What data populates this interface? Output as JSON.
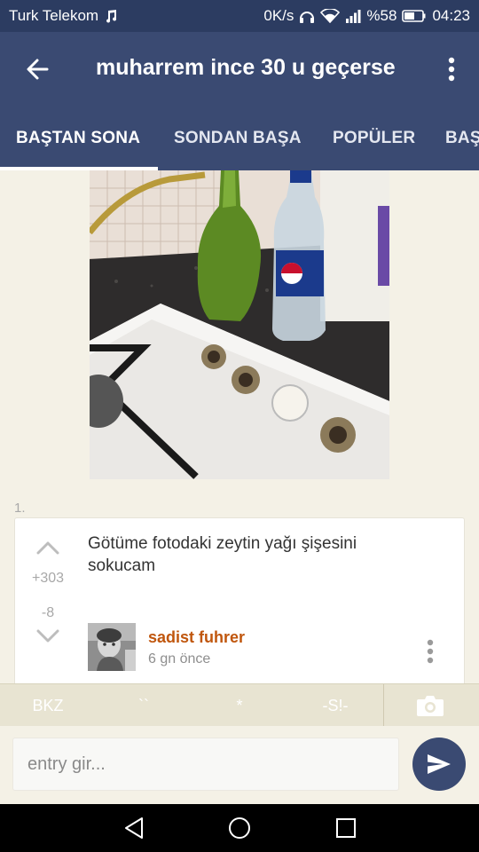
{
  "status_bar": {
    "carrier": "Turk Telekom",
    "net_speed": "0K/s",
    "battery": "%58",
    "time": "04:23"
  },
  "app_bar": {
    "title": "muharrem ince 30 u geçerse"
  },
  "tabs": [
    {
      "label": "BAŞTAN SONA",
      "active": true
    },
    {
      "label": "SONDAN BAŞA",
      "active": false
    },
    {
      "label": "POPÜLER",
      "active": false
    },
    {
      "label": "BAŞ",
      "active": false
    }
  ],
  "entry": {
    "number": "1.",
    "text": "Götüme fotodaki zeytin yağı şişesini sokucam",
    "upvotes": "+303",
    "downvotes": "-8",
    "author": "sadist fuhrer",
    "time": "6 gn  önce"
  },
  "toolbar": {
    "bkz": "BKZ",
    "backtick": "``",
    "star": "*",
    "spoiler": "-S!-"
  },
  "input": {
    "placeholder": "entry gir..."
  },
  "colors": {
    "primary": "#3a4a72",
    "status_bar": "#2c3c61",
    "background": "#f4f1e6",
    "author": "#c0560d"
  },
  "icons": {
    "back": "arrow-left-icon",
    "overflow": "more-vert-icon",
    "vote_up": "chevron-up-icon",
    "vote_down": "chevron-down-icon",
    "card_menu": "more-vert-icon",
    "camera": "camera-icon",
    "send": "send-icon"
  }
}
